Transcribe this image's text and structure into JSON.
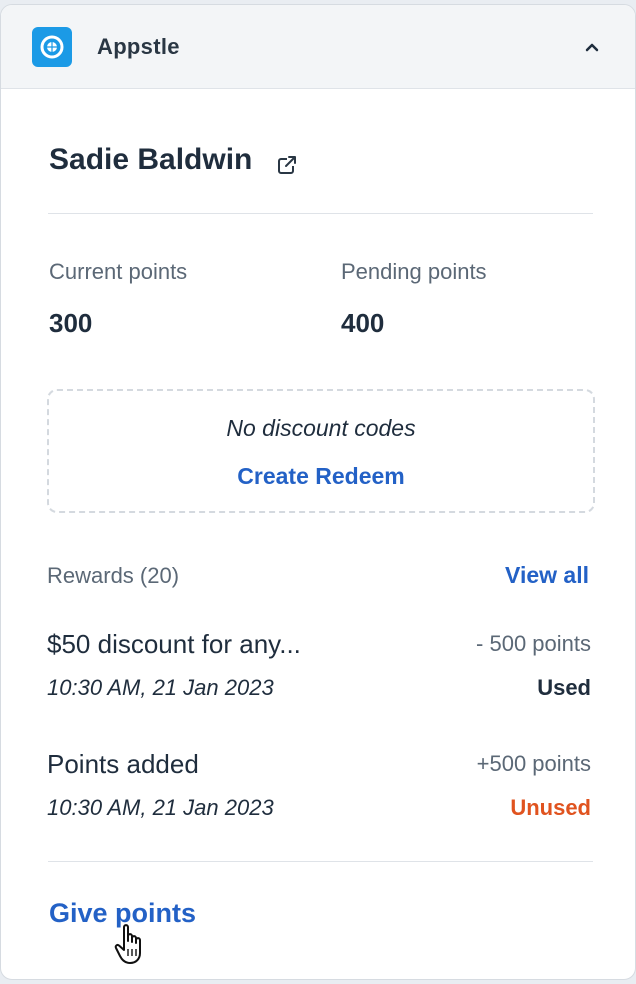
{
  "app": {
    "name": "Appstle",
    "icon": "appstle-logo-icon",
    "collapse_icon": "chevron-up-icon"
  },
  "customer": {
    "name": "Sadie Baldwin",
    "external_link_icon": "external-link-icon"
  },
  "points": {
    "current_label": "Current points",
    "current_value": "300",
    "pending_label": "Pending points",
    "pending_value": "400"
  },
  "discounts": {
    "empty_text": "No discount codes",
    "action_label": "Create Redeem"
  },
  "rewards": {
    "header": "Rewards (20)",
    "view_all_label": "View all",
    "items": [
      {
        "title": "$50 discount for any...",
        "date": "10:30 AM, 21 Jan 2023",
        "points": "- 500 points",
        "status": "Used"
      },
      {
        "title": "Points added",
        "date": "10:30 AM, 21 Jan 2023",
        "points": "+500 points",
        "status": "Unused"
      }
    ]
  },
  "footer": {
    "give_points_label": "Give points"
  },
  "colors": {
    "accent_blue": "#2361c6",
    "brand_icon": "#1b9ae6",
    "status_used": "#1f2d3d",
    "status_unused": "#e0531f",
    "muted_text": "#5b6876"
  }
}
